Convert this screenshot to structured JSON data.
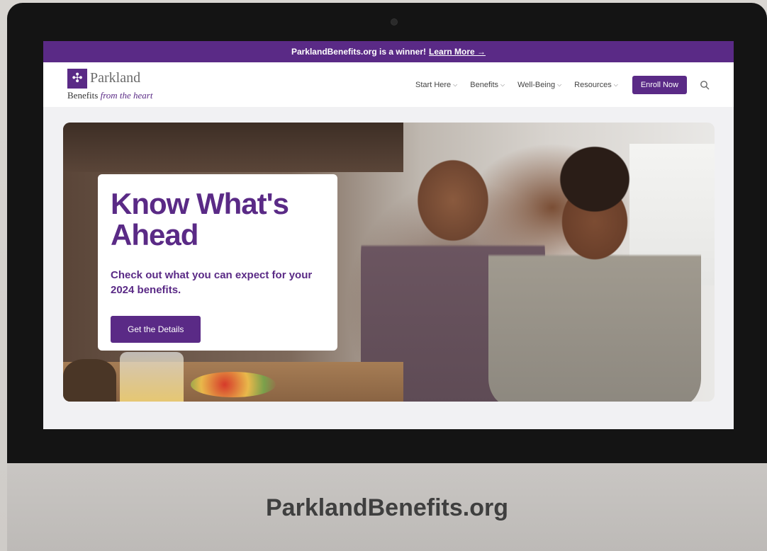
{
  "announcement": {
    "text": "ParklandBenefits.org is a winner!",
    "link": "Learn More →"
  },
  "logo": {
    "name": "Parkland",
    "tagline_plain": "Benefits",
    "tagline_italic": "from the heart"
  },
  "nav": {
    "items": [
      {
        "label": "Start Here"
      },
      {
        "label": "Benefits"
      },
      {
        "label": "Well-Being"
      },
      {
        "label": "Resources"
      }
    ],
    "enroll_label": "Enroll Now",
    "search_icon": "search-icon"
  },
  "hero": {
    "title": "Know What's Ahead",
    "subtitle": "Check out what you can expect for your 2024 benefits.",
    "button_label": "Get the Details"
  },
  "device_caption": "ParklandBenefits.org",
  "colors": {
    "brand_purple": "#5a2a86",
    "bezel": "#141414"
  }
}
